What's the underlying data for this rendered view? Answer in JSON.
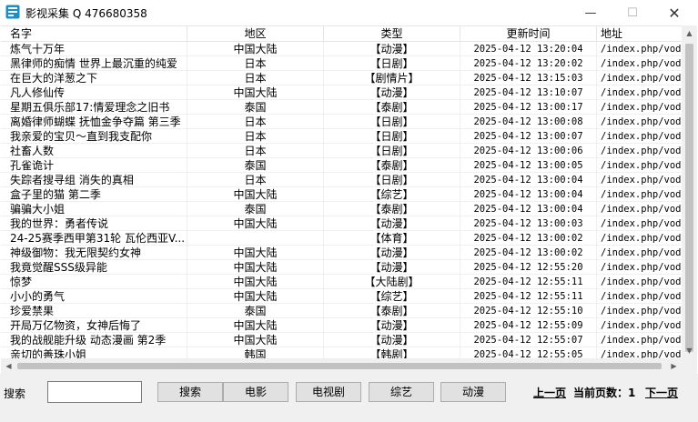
{
  "window": {
    "title": "影视采集  Q 476680358",
    "min_glyph": "—",
    "max_glyph": "☐",
    "close_glyph": "✕"
  },
  "table": {
    "columns": [
      "名字",
      "地区",
      "类型",
      "更新时间",
      "地址"
    ],
    "rows": [
      [
        "炼气十万年",
        "中国大陆",
        "【动漫】",
        "2025-04-12 13:20:04",
        "/index.php/vod"
      ],
      [
        "黑律师的痴情 世界上最沉重的纯爱",
        "日本",
        "【日剧】",
        "2025-04-12 13:20:02",
        "/index.php/vod"
      ],
      [
        "在巨大的洋葱之下",
        "日本",
        "【剧情片】",
        "2025-04-12 13:15:03",
        "/index.php/vod"
      ],
      [
        "凡人修仙传",
        "中国大陆",
        "【动漫】",
        "2025-04-12 13:10:07",
        "/index.php/vod"
      ],
      [
        "星期五俱乐部17:情爱理念之旧书",
        "泰国",
        "【泰剧】",
        "2025-04-12 13:00:17",
        "/index.php/vod"
      ],
      [
        "离婚律师蝴蝶 抚恤金争夺篇 第三季",
        "日本",
        "【日剧】",
        "2025-04-12 13:00:08",
        "/index.php/vod"
      ],
      [
        "我亲爱的宝贝～直到我支配你",
        "日本",
        "【日剧】",
        "2025-04-12 13:00:07",
        "/index.php/vod"
      ],
      [
        "社畜人数",
        "日本",
        "【日剧】",
        "2025-04-12 13:00:06",
        "/index.php/vod"
      ],
      [
        "孔雀诡计",
        "泰国",
        "【泰剧】",
        "2025-04-12 13:00:05",
        "/index.php/vod"
      ],
      [
        "失踪者搜寻组 消失的真相",
        "日本",
        "【日剧】",
        "2025-04-12 13:00:04",
        "/index.php/vod"
      ],
      [
        "盒子里的猫 第二季",
        "中国大陆",
        "【综艺】",
        "2025-04-12 13:00:04",
        "/index.php/vod"
      ],
      [
        "骗骗大小姐",
        "泰国",
        "【泰剧】",
        "2025-04-12 13:00:04",
        "/index.php/vod"
      ],
      [
        "我的世界：勇者传说",
        "中国大陆",
        "【动漫】",
        "2025-04-12 13:00:03",
        "/index.php/vod"
      ],
      [
        "24-25赛季西甲第31轮 瓦伦西亚V...",
        "",
        "【体育】",
        "2025-04-12 13:00:02",
        "/index.php/vod"
      ],
      [
        "神级御物：我无限契约女神",
        "中国大陆",
        "【动漫】",
        "2025-04-12 13:00:02",
        "/index.php/vod"
      ],
      [
        "我竟觉醒SSS级异能",
        "中国大陆",
        "【动漫】",
        "2025-04-12 12:55:20",
        "/index.php/vod"
      ],
      [
        "惊梦",
        "中国大陆",
        "【大陆剧】",
        "2025-04-12 12:55:11",
        "/index.php/vod"
      ],
      [
        "小小的勇气",
        "中国大陆",
        "【综艺】",
        "2025-04-12 12:55:11",
        "/index.php/vod"
      ],
      [
        "珍爱禁果",
        "泰国",
        "【泰剧】",
        "2025-04-12 12:55:10",
        "/index.php/vod"
      ],
      [
        "开局万亿物资，女神后悔了",
        "中国大陆",
        "【动漫】",
        "2025-04-12 12:55:09",
        "/index.php/vod"
      ],
      [
        "我的战舰能升级 动态漫画 第2季",
        "中国大陆",
        "【动漫】",
        "2025-04-12 12:55:07",
        "/index.php/vod"
      ],
      [
        "亲切的善珠小姐",
        "韩国",
        "【韩剧】",
        "2025-04-12 12:55:05",
        "/index.php/vod"
      ]
    ]
  },
  "bottom": {
    "search_label": "搜索",
    "search_value": "",
    "buttons": [
      "搜索",
      "电影",
      "电视剧",
      "综艺",
      "动漫"
    ],
    "prev_page": "上一页",
    "current_page": "当前页数：1",
    "next_page": "下一页"
  },
  "colors": {
    "icon": "#1e8ec8",
    "background": "#ffffff",
    "bar": "#f0f0f0"
  }
}
